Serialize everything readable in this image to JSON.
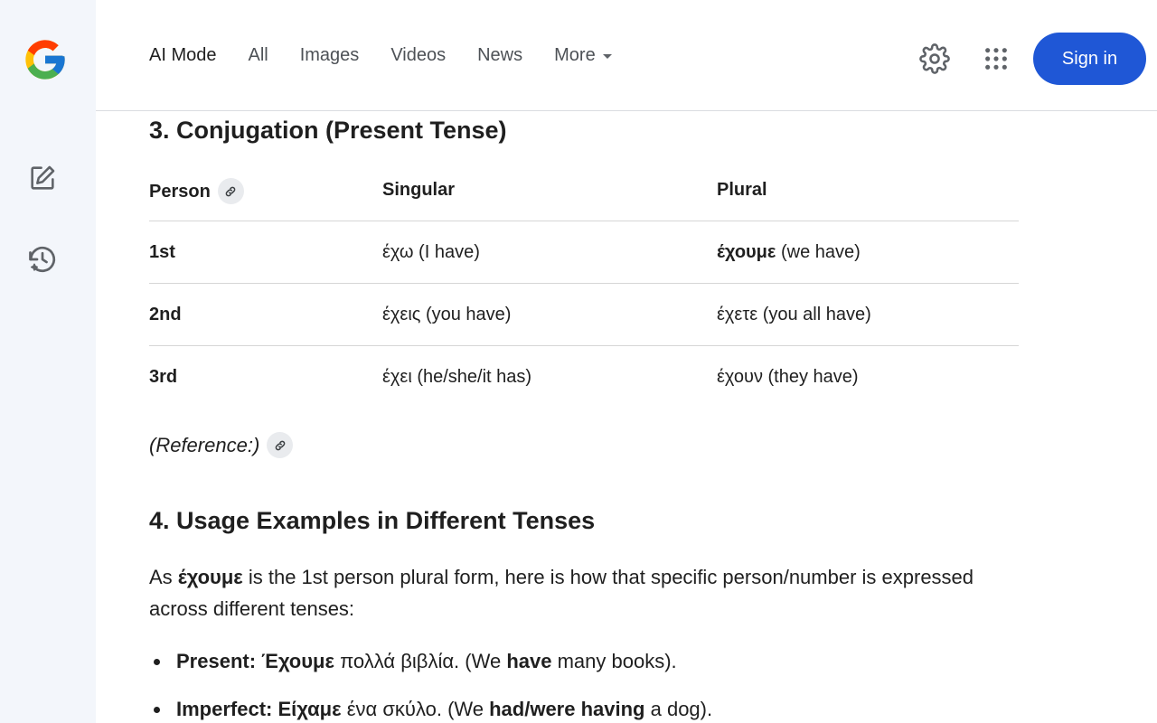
{
  "header": {
    "tabs": [
      {
        "label": "AI Mode"
      },
      {
        "label": "All"
      },
      {
        "label": "Images"
      },
      {
        "label": "Videos"
      },
      {
        "label": "News"
      },
      {
        "label": "More"
      }
    ],
    "sign_in_label": "Sign in"
  },
  "icons": {
    "logo": "google-logo",
    "new_chat": "edit-square-icon",
    "history": "history-sparkle-icon",
    "settings": "gear-icon",
    "apps": "apps-grid-icon",
    "link": "link-icon"
  },
  "colors": {
    "accent": "#1f57d6",
    "rail_bg": "#f3f6fb",
    "text": "#1f1f1f"
  },
  "section3": {
    "heading": "3. Conjugation (Present Tense)",
    "table": {
      "headers": [
        "Person",
        "Singular",
        "Plural"
      ],
      "rows": [
        {
          "person": "1st",
          "singular": "έχω (I have)",
          "plural_bold": "έχουμε",
          "plural_rest": " (we have)"
        },
        {
          "person": "2nd",
          "singular": "έχεις (you have)",
          "plural_bold": "",
          "plural_rest": "έχετε (you all have)"
        },
        {
          "person": "3rd",
          "singular": "έχει (he/she/it has)",
          "plural_bold": "",
          "plural_rest": "έχουν (they have)"
        }
      ]
    },
    "reference": "(Reference:)"
  },
  "section4": {
    "heading": "4. Usage Examples in Different Tenses",
    "intro_pre": "As ",
    "intro_bold": "έχουμε",
    "intro_post": " is the 1st person plural form, here is how that specific person/number is expressed across different tenses:",
    "bullets": [
      {
        "label": "Present:",
        "greek_bold": "Έχουμε",
        "greek_rest": " πολλά βιβλία. (We ",
        "en_bold": "have",
        "en_rest": " many books)."
      },
      {
        "label": "Imperfect:",
        "greek_bold": "Είχαμε",
        "greek_rest": " ένα σκύλο. (We ",
        "en_bold": "had/were having",
        "en_rest": " a dog)."
      }
    ]
  }
}
